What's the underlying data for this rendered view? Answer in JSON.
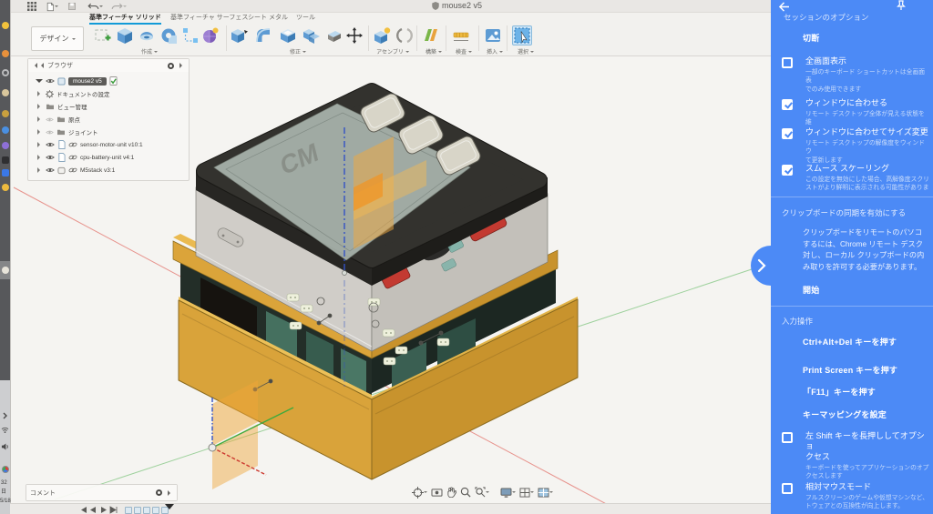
{
  "window_title": "mouse2 v5",
  "tabs": [
    "基準フィーチャ ソリッド",
    "基準フィーチャ サーフェス",
    "シート メタル",
    "ツール"
  ],
  "toolbar": {
    "design": "デザイン",
    "groups": [
      "作成",
      "修正",
      "アセンブリ",
      "構築",
      "検査",
      "挿入",
      "選択"
    ]
  },
  "browser": {
    "header": "ブラウザ",
    "root_label": "mouse2 v5",
    "items": [
      {
        "label": "ドキュメントの設定"
      },
      {
        "label": "ビュー管理"
      },
      {
        "label": "原点"
      },
      {
        "label": "ジョイント"
      },
      {
        "label": "sensor-motor-unit v10:1"
      },
      {
        "label": "cpu-battery-unit v4:1"
      },
      {
        "label": "M5stack v3:1"
      }
    ]
  },
  "comment": {
    "label": "コメント"
  },
  "dock": {
    "clock": [
      "32",
      "日",
      "5/18"
    ]
  },
  "model": {
    "screen_text": "CM"
  },
  "crd_panel": {
    "title": "セッションのオプション",
    "disconnect": "切断",
    "options": [
      {
        "label": "全画面表示",
        "checked": false,
        "sub1": "一部のキーボード ショートカットは全画面表",
        "sub2": "でのみ使用できます"
      },
      {
        "label": "ウィンドウに合わせる",
        "checked": true,
        "sub1": "リモート デスクトップ全体が見える状態を維",
        "sub2": ""
      },
      {
        "label": "ウィンドウに合わせてサイズ変更",
        "checked": true,
        "sub1": "リモート デスクトップの解像度をウィンドウ",
        "sub2": "て更新します"
      },
      {
        "label": "スムース スケーリング",
        "checked": true,
        "sub1": "この設定を無効にした場合、高解像度スクリ",
        "sub2": "ストがより鮮明に表示される可能性がありま"
      }
    ],
    "clipboard": {
      "heading": "クリップボードの同期を有効にする",
      "line1": "クリップボードをリモートのパソコ",
      "line2": "するには、Chrome リモート デスク",
      "line3": "対し、ローカル クリップボードの内",
      "line4": "み取りを許可する必要があります。",
      "start": "開始"
    },
    "input": {
      "heading": "入力操作",
      "action1": "Ctrl+Alt+Del キーを押す",
      "action2": "Print Screen キーを押す",
      "action3": "「F11」キーを押す",
      "action4": "キーマッピングを設定",
      "opt1_line1": "左 Shift キーを長押ししてオプショ",
      "opt1_line2": "クセス",
      "opt1_sub1": "キーボードを使ってアプリケーションのオプ",
      "opt1_sub2": "クセスします",
      "opt2_label": "相対マウスモード",
      "opt2_sub1": "フルスクリーンのゲームや仮想マシンなど、",
      "opt2_sub2": "トウェアとの互換性が向上します。"
    }
  },
  "colors": {
    "panel_blue": "#4c8af6",
    "tab_accent": "#129bd8",
    "model_orange": "#d9a33a",
    "model_red": "#c33a31",
    "canvas_bg": "#f7f6f3"
  }
}
